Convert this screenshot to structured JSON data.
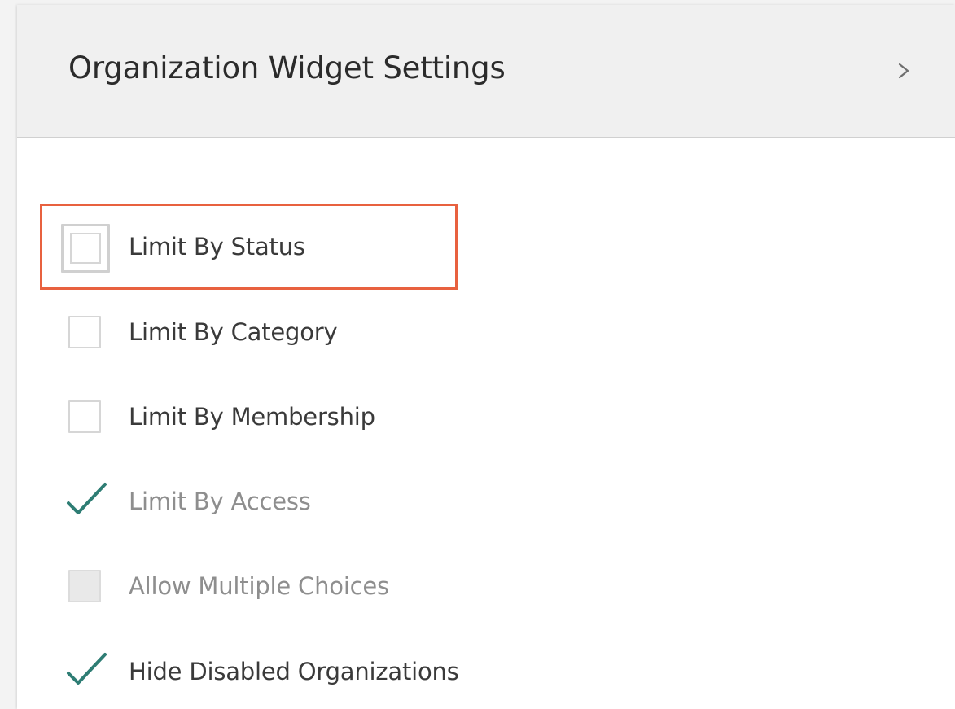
{
  "header": {
    "title": "Organization Widget Settings",
    "expand_icon": "chevron-right-icon"
  },
  "options": [
    {
      "label": "Limit By Status",
      "checked": false,
      "disabled": false,
      "focused": true
    },
    {
      "label": "Limit By Category",
      "checked": false,
      "disabled": false,
      "focused": false
    },
    {
      "label": "Limit By Membership",
      "checked": false,
      "disabled": false,
      "focused": false
    },
    {
      "label": "Limit By Access",
      "checked": true,
      "disabled": true,
      "focused": false
    },
    {
      "label": "Allow Multiple Choices",
      "checked": false,
      "disabled": true,
      "focused": false
    },
    {
      "label": "Hide Disabled Organizations",
      "checked": true,
      "disabled": false,
      "focused": false
    }
  ],
  "colors": {
    "accent_check": "#2e7d74",
    "highlight": "#e8613f",
    "header_bg": "#f0f0f0"
  }
}
